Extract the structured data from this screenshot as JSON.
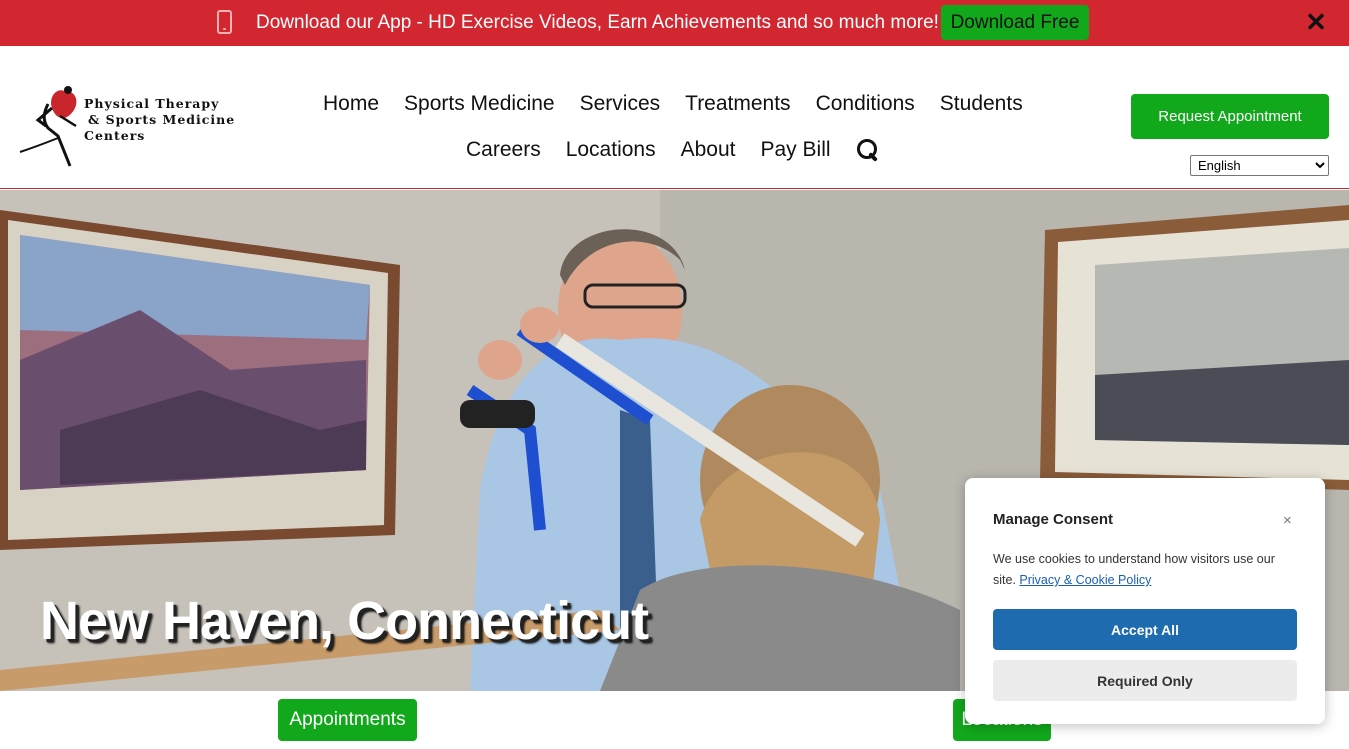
{
  "promo": {
    "text": "Download our App - HD Exercise Videos, Earn Achievements and so much more!",
    "button": "Download Free",
    "close": "✕",
    "icon": "phone-icon"
  },
  "logo": {
    "line1": "Physical Therapy",
    "line2": "& Sports Medicine",
    "line3": "Centers"
  },
  "nav": {
    "row1": [
      "Home",
      "Sports Medicine",
      "Services",
      "Treatments",
      "Conditions",
      "Students"
    ],
    "row2": [
      "Careers",
      "Locations",
      "About",
      "Pay Bill"
    ]
  },
  "header": {
    "request_button": "Request Appointment",
    "language": "English"
  },
  "hero": {
    "title": "New Haven, Connecticut"
  },
  "bottom": {
    "appointments": "Appointments",
    "locations": "Locations"
  },
  "consent": {
    "title": "Manage Consent",
    "close": "×",
    "text": "We use cookies to understand how visitors use our site.",
    "link": "Privacy & Cookie Policy",
    "accept": "Accept All",
    "required_only": "Required Only"
  },
  "colors": {
    "brand_red": "#d22630",
    "cta_green": "#12a81c",
    "consent_blue": "#1e6bb0"
  }
}
